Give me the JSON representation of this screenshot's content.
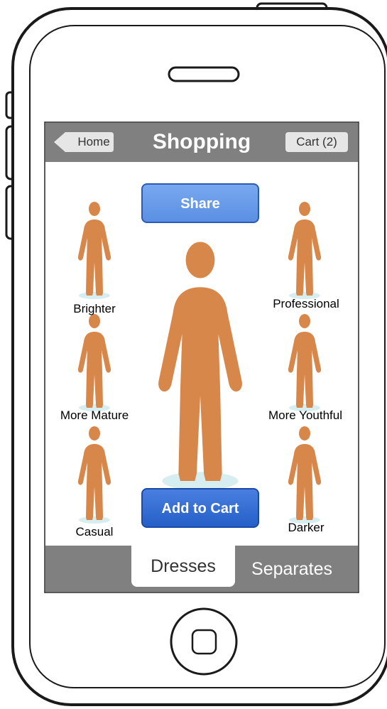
{
  "navbar": {
    "title": "Shopping",
    "back_label": "Home",
    "cart_label": "Cart (2)"
  },
  "actions": {
    "share_label": "Share",
    "add_to_cart_label": "Add to Cart"
  },
  "variants": {
    "brighter": "Brighter",
    "more_mature": "More Mature",
    "casual": "Casual",
    "professional": "Professional",
    "more_youthful": "More Youthful",
    "darker": "Darker"
  },
  "tabs": {
    "dresses": "Dresses",
    "separates": "Separates"
  },
  "colors": {
    "figure": "#d8874a",
    "platform": "#d6eef0",
    "bar_gray": "#808080",
    "share_blue": "#5a8fe3",
    "cart_blue": "#2460c8"
  }
}
